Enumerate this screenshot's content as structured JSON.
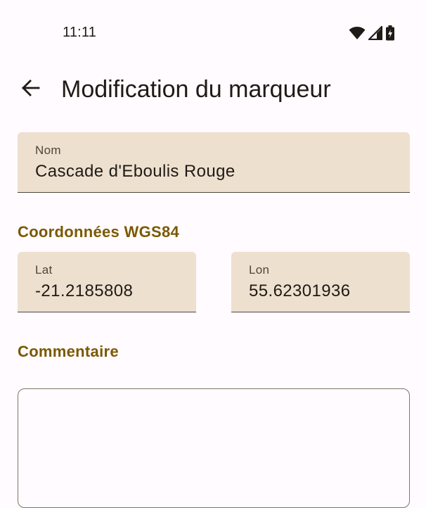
{
  "status_bar": {
    "time": "11:11",
    "icons": [
      "wifi-icon",
      "cell-signal-icon",
      "battery-charging-icon"
    ]
  },
  "top_bar": {
    "back_icon": "arrow-back-icon",
    "title": "Modification du marqueur"
  },
  "form": {
    "name": {
      "label": "Nom",
      "value": "Cascade d'Eboulis Rouge"
    },
    "coordinates_title": "Coordonnées WGS84",
    "lat": {
      "label": "Lat",
      "value": "-21.2185808"
    },
    "lon": {
      "label": "Lon",
      "value": "55.62301936"
    },
    "comment_title": "Commentaire",
    "comment": {
      "value": ""
    }
  },
  "colors": {
    "background": "#fffbfe",
    "field_fill": "#eee0cf",
    "accent": "#7a5900",
    "text": "#1e1b16",
    "outline": "#7f7667"
  }
}
